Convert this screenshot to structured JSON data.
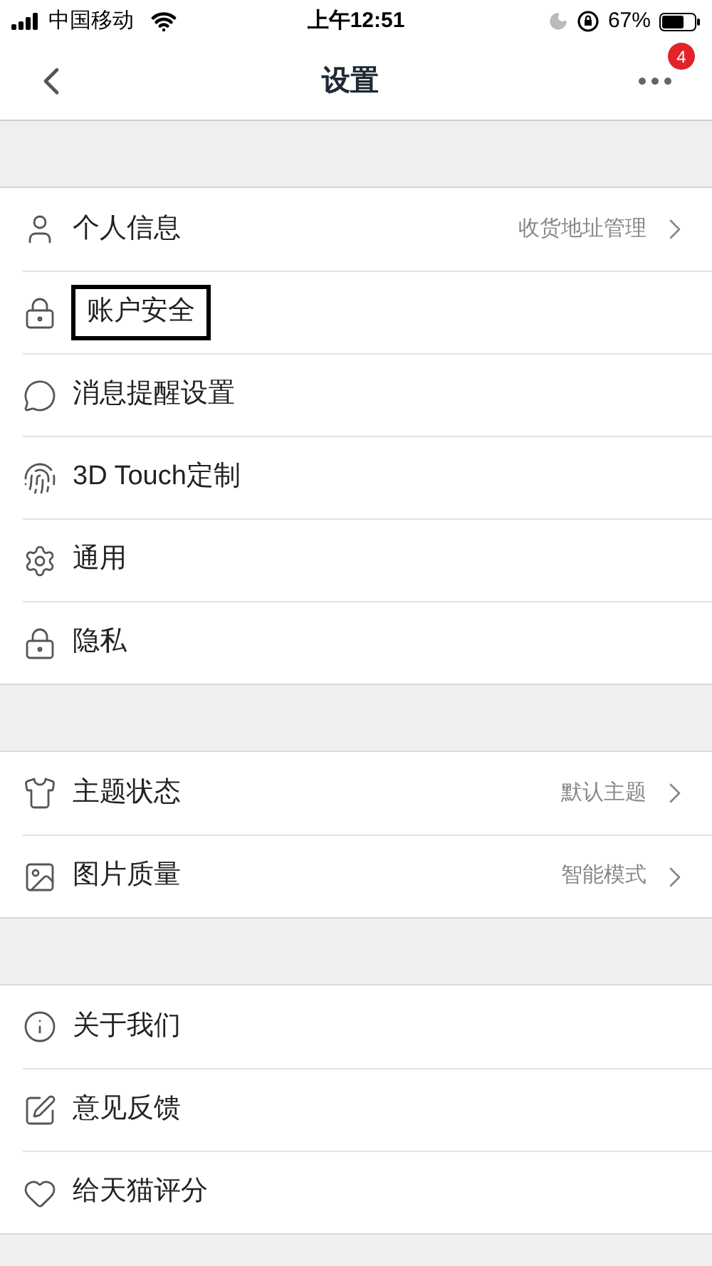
{
  "status_bar": {
    "carrier": "中国移动",
    "time": "上午12:51",
    "battery": "67%"
  },
  "nav": {
    "title": "设置",
    "badge": "4"
  },
  "groups": [
    {
      "items": [
        {
          "label": "个人信息",
          "value": "收货地址管理",
          "chevron": true,
          "highlighted": false
        },
        {
          "label": "账户安全",
          "chevron": false,
          "highlighted": true
        },
        {
          "label": "消息提醒设置",
          "chevron": false,
          "highlighted": false
        },
        {
          "label": "3D Touch定制",
          "chevron": false,
          "highlighted": false
        },
        {
          "label": "通用",
          "chevron": false,
          "highlighted": false
        },
        {
          "label": "隐私",
          "chevron": false,
          "highlighted": false
        }
      ]
    },
    {
      "items": [
        {
          "label": "主题状态",
          "value": "默认主题",
          "chevron": true,
          "highlighted": false
        },
        {
          "label": "图片质量",
          "value": "智能模式",
          "chevron": true,
          "highlighted": false
        }
      ]
    },
    {
      "items": [
        {
          "label": "关于我们",
          "chevron": false,
          "highlighted": false
        },
        {
          "label": "意见反馈",
          "chevron": false,
          "highlighted": false
        },
        {
          "label": "给天猫评分",
          "chevron": false,
          "highlighted": false
        }
      ]
    }
  ]
}
